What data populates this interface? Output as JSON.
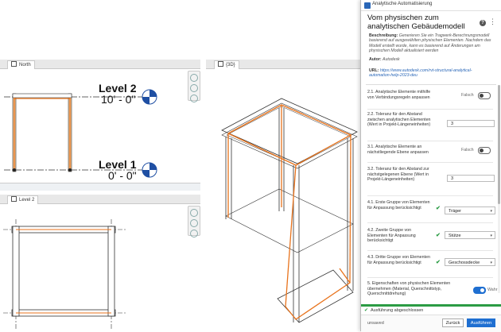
{
  "views": {
    "north": {
      "tab": "North",
      "levels": [
        {
          "name": "Level 2",
          "elevation": "10' - 0\""
        },
        {
          "name": "Level 1",
          "elevation": "0' - 0\""
        }
      ]
    },
    "threed": {
      "tab": "{3D}"
    },
    "level2": {
      "tab": "Level 2"
    }
  },
  "panel": {
    "window_title": "Analytische Automatisierung",
    "heading": "Vom physischen zum analytischen Gebäudemodell",
    "help": "?",
    "more": "⋮",
    "description_label": "Beschreibung:",
    "description": "Generieren Sie ein Tragwerk-Berechnungsmodell basierend auf ausgewählten physischen Elementen. Nachdem das Modell erstellt wurde, kann es basierend auf Änderungen am physischen Modell aktualisiert werden",
    "author_label": "Autor:",
    "author": "Autodesk",
    "url_label": "URL:",
    "url": "https://www.autodesk.com/rvt-structural-analytical-automation-help-2023-deu",
    "rows": [
      {
        "label": "2.1. Analytische Elemente mithilfe von Verbindungsregeln anpassen",
        "toggle_text": "Falsch"
      },
      {
        "label": "2.2. Toleranz für den Abstand zwischen analytischen Elementen (Wert in Projekt-Längeneinheiten)",
        "value": "3"
      },
      {
        "label": "3.1. Analytische Elemente an nächstliegende Ebene anpassen",
        "toggle_text": "Falsch"
      },
      {
        "label": "3.2. Toleranz für den Abstand zur nächstgelegenen Ebene (Wert in Projekt-Längeneinheiten)",
        "value": "3"
      },
      {
        "label": "4.1. Erste Gruppe von Elementen für Anpassung berücksichtigt",
        "select": "Träger"
      },
      {
        "label": "4.2. Zweite Gruppe von Elementen für Anpassung berücksichtigt",
        "select": "Stütze"
      },
      {
        "label": "4.3. Dritte Gruppe von Elementen für Anpassung berücksichtigt",
        "select": "Geschossdecke"
      },
      {
        "label": "5. Eigenschaften von physischen Elementen übernehmen (Material, Querschnittstyp, Querschnittdrehung)",
        "toggle_text": "Wahr"
      }
    ],
    "status": "Ausführung abgeschlossen",
    "unsaved": "unsaved",
    "back_button": "Zurück",
    "run_button": "Ausführen"
  }
}
